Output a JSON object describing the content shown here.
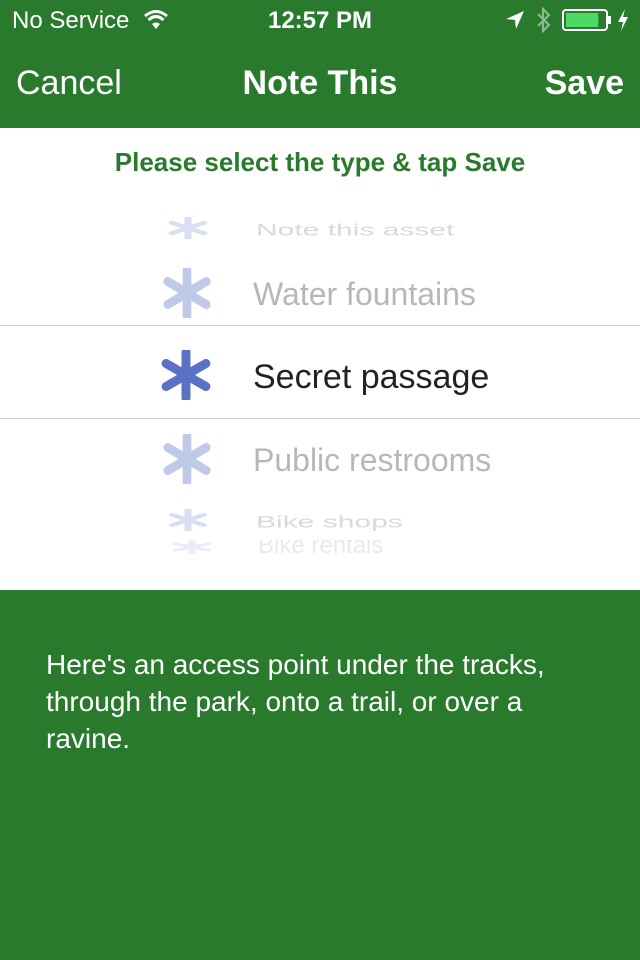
{
  "status_bar": {
    "carrier": "No Service",
    "time": "12:57 PM",
    "battery_level": 0.85
  },
  "nav": {
    "cancel_label": "Cancel",
    "title": "Note This",
    "save_label": "Save"
  },
  "picker": {
    "instruction": "Please select the type & tap Save",
    "options": [
      {
        "label": "Note this asset"
      },
      {
        "label": "Water fountains"
      },
      {
        "label": "Secret passage"
      },
      {
        "label": "Public restrooms"
      },
      {
        "label": "Bike shops"
      },
      {
        "label": "Bike rentals"
      }
    ],
    "selected_index": 2
  },
  "description": "Here's an access point under the tracks, through the park, onto a trail, or over a ravine.",
  "colors": {
    "brand_green": "#2a7a2e",
    "asterisk_blue": "#5a72c4",
    "panel_background": "#ffffff"
  },
  "icons": {
    "option_icon": "asterisk-icon"
  }
}
